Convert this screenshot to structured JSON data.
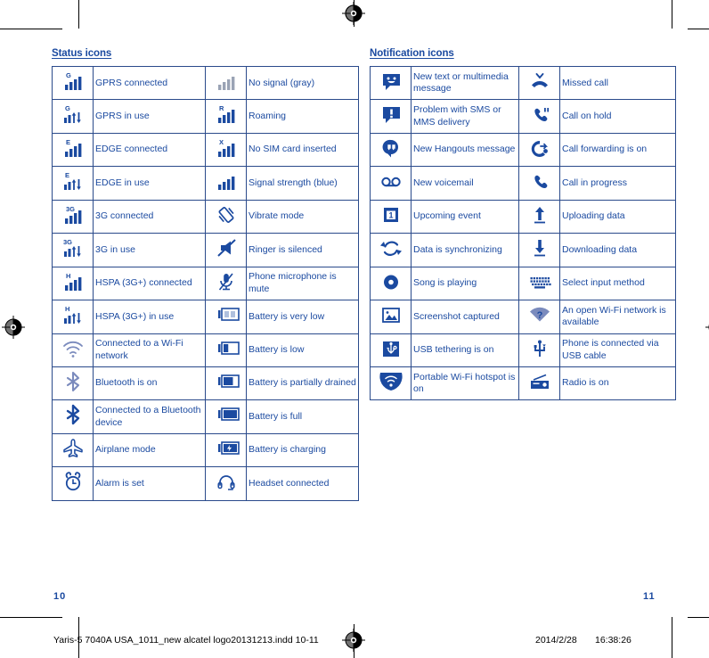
{
  "document": {
    "left_page_number": "10",
    "right_page_number": "11",
    "slug_filename": "Yaris-5 7040A USA_1011_new alcatel logo20131213.indd   10-11",
    "slug_date": "2014/2/28",
    "slug_time": "16:38:26",
    "accent_color": "#1b4aa0",
    "border_color": "#2a4a8b",
    "gray_icon_color": "#9aa3b5",
    "light_icon_color": "#7b8bbd"
  },
  "status_section": {
    "title": "Status icons",
    "rows": [
      {
        "left": {
          "icon": "signal-gprs-connected-icon",
          "label": "GPRS connected"
        },
        "right": {
          "icon": "signal-no-signal-gray-icon",
          "label": "No signal (gray)"
        }
      },
      {
        "left": {
          "icon": "signal-gprs-in-use-icon",
          "label": "GPRS in use"
        },
        "right": {
          "icon": "signal-roaming-icon",
          "label": "Roaming"
        }
      },
      {
        "left": {
          "icon": "signal-edge-connected-icon",
          "label": "EDGE connected"
        },
        "right": {
          "icon": "signal-no-sim-icon",
          "label": "No SIM card inserted"
        }
      },
      {
        "left": {
          "icon": "signal-edge-in-use-icon",
          "label": "EDGE in use"
        },
        "right": {
          "icon": "signal-strength-blue-icon",
          "label": "Signal strength (blue)"
        }
      },
      {
        "left": {
          "icon": "signal-3g-connected-icon",
          "label": "3G connected"
        },
        "right": {
          "icon": "vibrate-mode-icon",
          "label": "Vibrate mode"
        }
      },
      {
        "left": {
          "icon": "signal-3g-in-use-icon",
          "label": "3G in use"
        },
        "right": {
          "icon": "ringer-silenced-icon",
          "label": "Ringer is silenced"
        }
      },
      {
        "left": {
          "icon": "signal-hspa-connected-icon",
          "label": "HSPA (3G+) connected"
        },
        "right": {
          "icon": "microphone-mute-icon",
          "label": "Phone microphone is mute"
        }
      },
      {
        "left": {
          "icon": "signal-hspa-in-use-icon",
          "label": "HSPA (3G+) in use"
        },
        "right": {
          "icon": "battery-very-low-icon",
          "label": "Battery is very low"
        }
      },
      {
        "left": {
          "icon": "wifi-connected-icon",
          "label": "Connected to a Wi-Fi network"
        },
        "right": {
          "icon": "battery-low-icon",
          "label": "Battery is low"
        }
      },
      {
        "left": {
          "icon": "bluetooth-on-icon",
          "label": "Bluetooth is on"
        },
        "right": {
          "icon": "battery-partially-drained-icon",
          "label": "Battery is partially drained"
        }
      },
      {
        "left": {
          "icon": "bluetooth-connected-icon",
          "label": "Connected to a Bluetooth device"
        },
        "right": {
          "icon": "battery-full-icon",
          "label": "Battery is full"
        }
      },
      {
        "left": {
          "icon": "airplane-mode-icon",
          "label": "Airplane mode"
        },
        "right": {
          "icon": "battery-charging-icon",
          "label": "Battery is charging"
        }
      },
      {
        "left": {
          "icon": "alarm-set-icon",
          "label": "Alarm is set"
        },
        "right": {
          "icon": "headset-connected-icon",
          "label": "Headset connected"
        }
      }
    ]
  },
  "notification_section": {
    "title": "Notification icons",
    "rows": [
      {
        "left": {
          "icon": "new-message-icon",
          "label": "New text or multimedia message"
        },
        "right": {
          "icon": "missed-call-icon",
          "label": "Missed call"
        }
      },
      {
        "left": {
          "icon": "message-problem-icon",
          "label": "Problem with SMS or MMS delivery"
        },
        "right": {
          "icon": "call-on-hold-icon",
          "label": "Call on hold"
        }
      },
      {
        "left": {
          "icon": "hangouts-message-icon",
          "label": "New Hangouts message"
        },
        "right": {
          "icon": "call-forwarding-icon",
          "label": "Call forwarding is on"
        }
      },
      {
        "left": {
          "icon": "voicemail-icon",
          "label": "New voicemail"
        },
        "right": {
          "icon": "call-in-progress-icon",
          "label": "Call in progress"
        }
      },
      {
        "left": {
          "icon": "calendar-event-icon",
          "label": "Upcoming event"
        },
        "right": {
          "icon": "upload-icon",
          "label": "Uploading data"
        }
      },
      {
        "left": {
          "icon": "sync-icon",
          "label": "Data is synchronizing"
        },
        "right": {
          "icon": "download-icon",
          "label": "Downloading data"
        }
      },
      {
        "left": {
          "icon": "music-playing-icon",
          "label": "Song is playing"
        },
        "right": {
          "icon": "keyboard-icon",
          "label": "Select input method"
        }
      },
      {
        "left": {
          "icon": "screenshot-icon",
          "label": "Screenshot captured"
        },
        "right": {
          "icon": "wifi-open-network-icon",
          "label": "An open Wi-Fi network is available"
        }
      },
      {
        "left": {
          "icon": "usb-tethering-icon",
          "label": "USB tethering is on"
        },
        "right": {
          "icon": "usb-cable-icon",
          "label": "Phone is connected via USB cable"
        }
      },
      {
        "left": {
          "icon": "wifi-hotspot-icon",
          "label": "Portable Wi-Fi hotspot is on"
        },
        "right": {
          "icon": "radio-icon",
          "label": "Radio is on"
        }
      }
    ]
  }
}
